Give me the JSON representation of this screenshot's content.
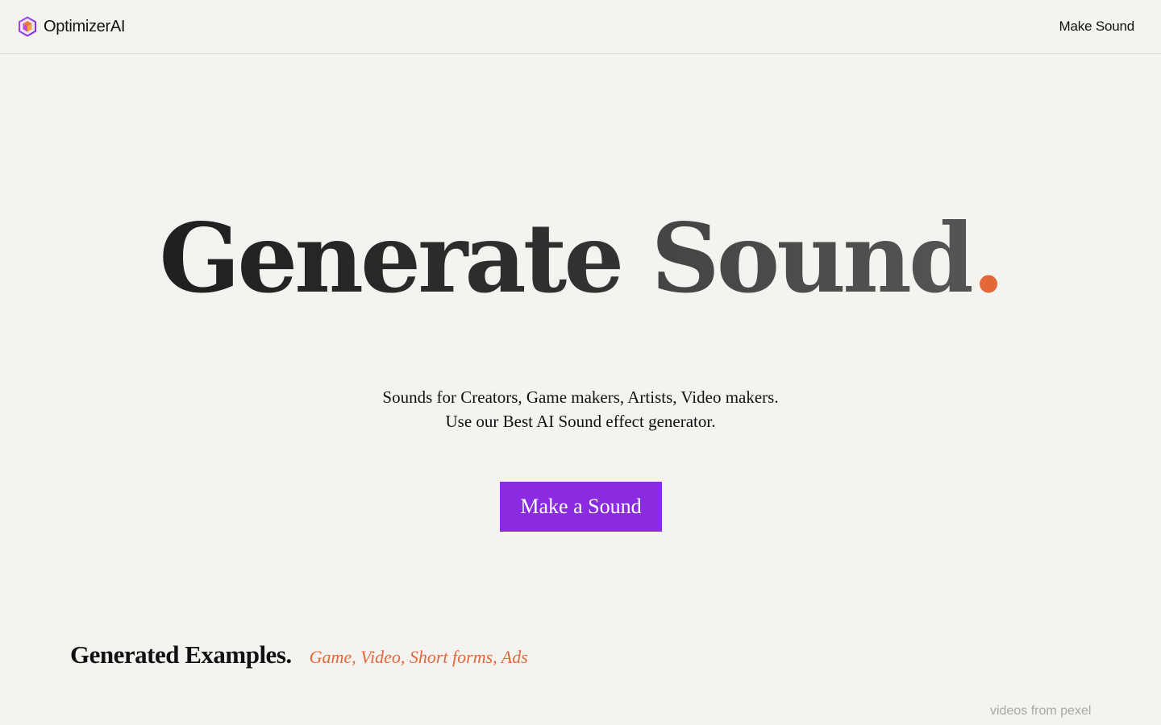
{
  "header": {
    "brand_name": "OptimizerAI",
    "brand_logo_icon": "hexagon-cube-logo-icon",
    "nav_link": "Make Sound"
  },
  "hero": {
    "title_word_1": "Generate",
    "title_word_2": "Sound",
    "title_dot": ".",
    "subtitle_line_1": "Sounds for Creators, Game makers, Artists, Video makers.",
    "subtitle_line_2": "Use our Best AI Sound effect generator.",
    "cta_label": "Make a Sound"
  },
  "examples": {
    "heading": "Generated Examples.",
    "tags": "Game, Video, Short forms, Ads"
  },
  "footer": {
    "credit": "videos from pexel"
  },
  "colors": {
    "background": "#f4f3f0",
    "accent_orange": "#e4673a",
    "cta_purple": "#8a2be2"
  }
}
